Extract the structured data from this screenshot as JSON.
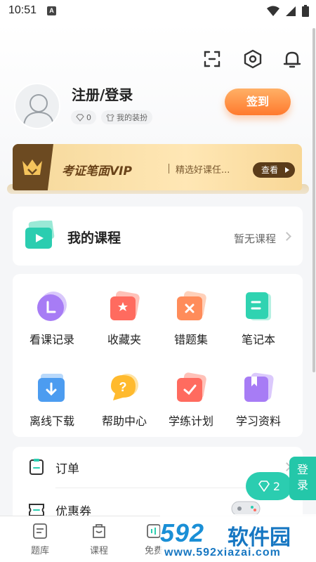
{
  "status_bar": {
    "time": "10:51",
    "notification_letter": "A"
  },
  "header": {
    "icons": [
      "scan-icon",
      "settings-icon",
      "bell-icon"
    ]
  },
  "profile": {
    "title": "注册/登录",
    "points": "0",
    "dress_label": "我的装扮",
    "signin_label": "签到"
  },
  "vip": {
    "title": "考证笔面VIP",
    "subtitle": "精选好课任...",
    "button_label": "查看"
  },
  "my_course": {
    "title": "我的课程",
    "status": "暂无课程"
  },
  "features": [
    {
      "label": "看课记录",
      "icon": "history-icon",
      "color": "#a77cf5"
    },
    {
      "label": "收藏夹",
      "icon": "favorite-icon",
      "color": "#ff6b5f"
    },
    {
      "label": "错题集",
      "icon": "wrong-question-icon",
      "color": "#ff8c5a"
    },
    {
      "label": "笔记本",
      "icon": "notebook-icon",
      "color": "#2fd3b1"
    },
    {
      "label": "离线下载",
      "icon": "download-icon",
      "color": "#4c9cf0"
    },
    {
      "label": "帮助中心",
      "icon": "help-icon",
      "color": "#ffba2e"
    },
    {
      "label": "学练计划",
      "icon": "plan-icon",
      "color": "#ff6b5f"
    },
    {
      "label": "学习资料",
      "icon": "materials-icon",
      "color": "#a77cf5"
    }
  ],
  "list": [
    {
      "label": "订单",
      "icon": "order-icon"
    },
    {
      "label": "优惠券",
      "icon": "coupon-icon"
    }
  ],
  "tabs": [
    {
      "label": "题库",
      "icon": "question-bank-icon"
    },
    {
      "label": "课程",
      "icon": "course-icon"
    },
    {
      "label": "免费",
      "icon": "free-icon"
    }
  ],
  "floating": {
    "login_line1": "登",
    "login_line2": "录",
    "count": "2"
  },
  "watermark": {
    "logo": "592",
    "name": "软件园",
    "url": "www.592xiazai.com"
  },
  "colors": {
    "accent": "#2bcdb0",
    "signin": "#ff7a2e",
    "vip_dark": "#5b3c1a"
  }
}
